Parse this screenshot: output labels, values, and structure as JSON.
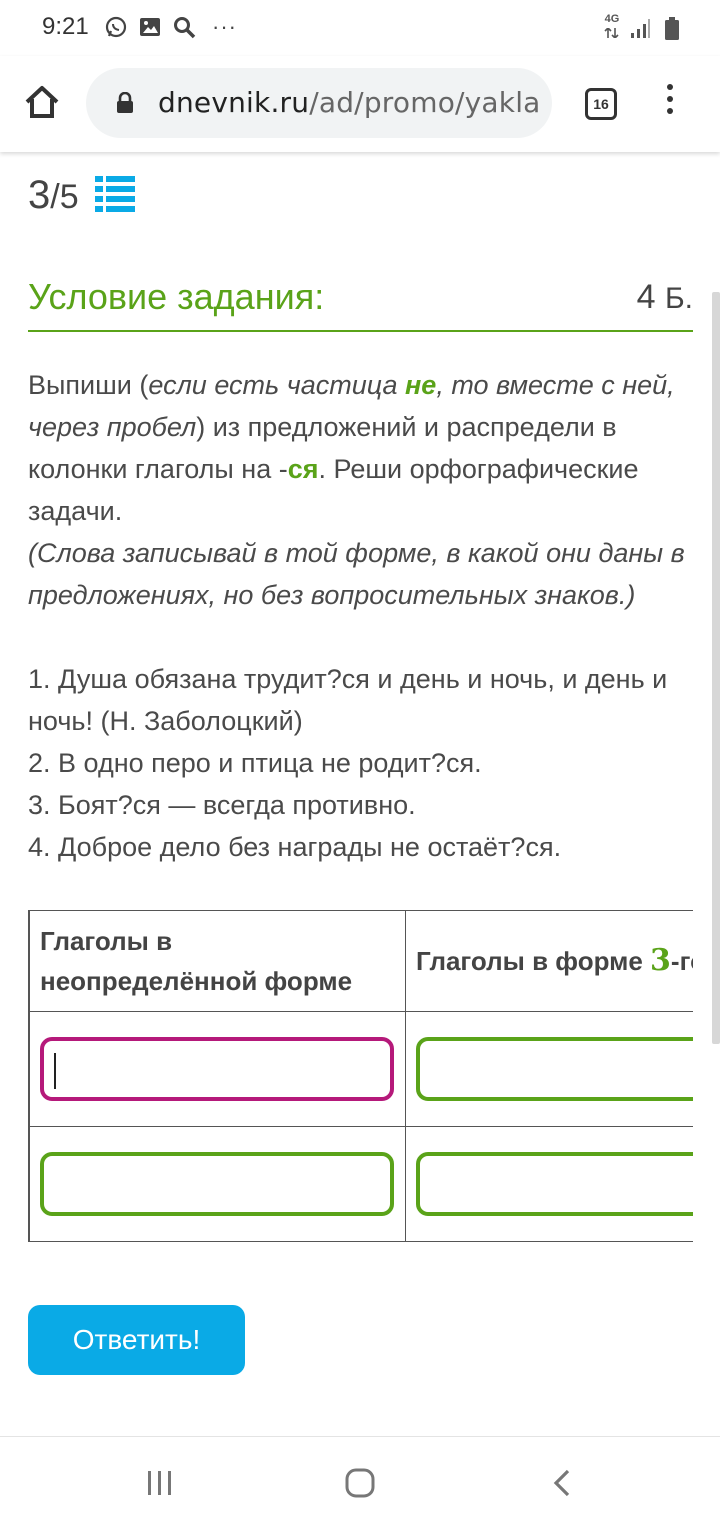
{
  "status_bar": {
    "time": "9:21",
    "more": "···",
    "network": "4G",
    "left_icons": [
      "whatsapp-icon",
      "image-icon",
      "search-icon"
    ]
  },
  "browser": {
    "url_domain": "dnevnik.ru",
    "url_path": "/ad/promo/yakla",
    "tab_count": "16"
  },
  "progress": {
    "current": "3",
    "total": "5",
    "separator": "/"
  },
  "task": {
    "title": "Условие задания:",
    "points_value": "4",
    "points_unit": "Б.",
    "instr_1": "Выпиши (",
    "instr_2": "если есть частица ",
    "instr_3": "не",
    "instr_4": ", то вместе с ней, через пробел",
    "instr_5": ") из предложений и распредели в колонки глаголы на -",
    "instr_6": "ся",
    "instr_7": ". Реши орфографические задачи.",
    "note": "(Слова записывай в той форме, в какой они даны в предложениях, но без вопросительных знаков.)",
    "sentences": [
      "1. Душа обязана трудит?ся и день и ночь, и день и ночь! (Н. Заболоцкий)",
      "2. В одно перо и птица не родит?ся.",
      "3. Боят?ся — всегда противно.",
      "4. Доброе дело без награды не остаёт?ся."
    ]
  },
  "table": {
    "col1_header": "Глаголы в неопределённой форме",
    "col2_header_prefix": "Глаголы в форме ",
    "col2_header_num": "3",
    "col2_header_suffix": "-го лица"
  },
  "submit_label": "Ответить!",
  "colors": {
    "accent_green": "#5aa319",
    "focus_magenta": "#b5197a",
    "button_blue": "#0aaae6",
    "list_icon_blue": "#0aaae6"
  }
}
